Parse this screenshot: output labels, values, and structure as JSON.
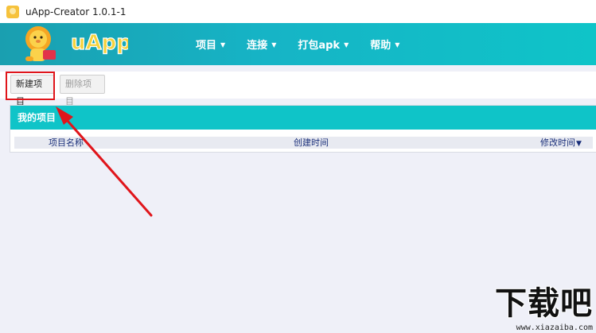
{
  "window": {
    "title": "uApp-Creator 1.0.1-1"
  },
  "header": {
    "logo_text": "uApp",
    "nav": [
      {
        "label": "项目"
      },
      {
        "label": "连接"
      },
      {
        "label": "打包apk"
      },
      {
        "label": "帮助"
      }
    ]
  },
  "toolbar": {
    "new_label": "新建项目",
    "delete_label": "删除项目"
  },
  "projects": {
    "title": "我的项目",
    "columns": [
      {
        "label": "项目名称"
      },
      {
        "label": "创建时间"
      },
      {
        "label": "修改时间",
        "sort": "descending"
      }
    ],
    "rows": []
  },
  "watermark": {
    "text_cn": "下载吧",
    "url": "www.xiazaiba.com"
  },
  "colors": {
    "header": "#16b4c6",
    "panel_header": "#0fc4c8",
    "annotation": "#e0151b",
    "background": "#eff0f8"
  }
}
